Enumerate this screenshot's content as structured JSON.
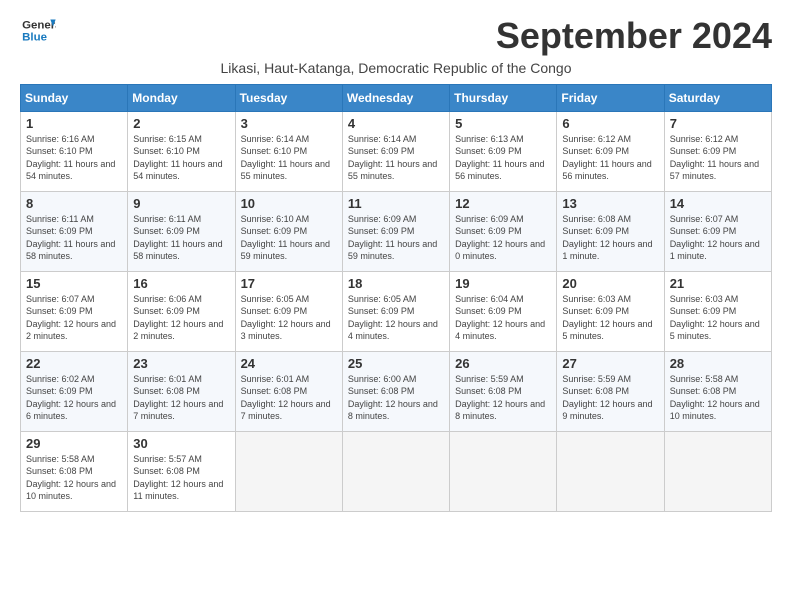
{
  "logo": {
    "line1": "General",
    "line2": "Blue"
  },
  "title": "September 2024",
  "subtitle": "Likasi, Haut-Katanga, Democratic Republic of the Congo",
  "days_of_week": [
    "Sunday",
    "Monday",
    "Tuesday",
    "Wednesday",
    "Thursday",
    "Friday",
    "Saturday"
  ],
  "weeks": [
    [
      {
        "num": "1",
        "sunrise": "6:16 AM",
        "sunset": "6:10 PM",
        "daylight": "11 hours and 54 minutes."
      },
      {
        "num": "2",
        "sunrise": "6:15 AM",
        "sunset": "6:10 PM",
        "daylight": "11 hours and 54 minutes."
      },
      {
        "num": "3",
        "sunrise": "6:14 AM",
        "sunset": "6:10 PM",
        "daylight": "11 hours and 55 minutes."
      },
      {
        "num": "4",
        "sunrise": "6:14 AM",
        "sunset": "6:09 PM",
        "daylight": "11 hours and 55 minutes."
      },
      {
        "num": "5",
        "sunrise": "6:13 AM",
        "sunset": "6:09 PM",
        "daylight": "11 hours and 56 minutes."
      },
      {
        "num": "6",
        "sunrise": "6:12 AM",
        "sunset": "6:09 PM",
        "daylight": "11 hours and 56 minutes."
      },
      {
        "num": "7",
        "sunrise": "6:12 AM",
        "sunset": "6:09 PM",
        "daylight": "11 hours and 57 minutes."
      }
    ],
    [
      {
        "num": "8",
        "sunrise": "6:11 AM",
        "sunset": "6:09 PM",
        "daylight": "11 hours and 58 minutes."
      },
      {
        "num": "9",
        "sunrise": "6:11 AM",
        "sunset": "6:09 PM",
        "daylight": "11 hours and 58 minutes."
      },
      {
        "num": "10",
        "sunrise": "6:10 AM",
        "sunset": "6:09 PM",
        "daylight": "11 hours and 59 minutes."
      },
      {
        "num": "11",
        "sunrise": "6:09 AM",
        "sunset": "6:09 PM",
        "daylight": "11 hours and 59 minutes."
      },
      {
        "num": "12",
        "sunrise": "6:09 AM",
        "sunset": "6:09 PM",
        "daylight": "12 hours and 0 minutes."
      },
      {
        "num": "13",
        "sunrise": "6:08 AM",
        "sunset": "6:09 PM",
        "daylight": "12 hours and 1 minute."
      },
      {
        "num": "14",
        "sunrise": "6:07 AM",
        "sunset": "6:09 PM",
        "daylight": "12 hours and 1 minute."
      }
    ],
    [
      {
        "num": "15",
        "sunrise": "6:07 AM",
        "sunset": "6:09 PM",
        "daylight": "12 hours and 2 minutes."
      },
      {
        "num": "16",
        "sunrise": "6:06 AM",
        "sunset": "6:09 PM",
        "daylight": "12 hours and 2 minutes."
      },
      {
        "num": "17",
        "sunrise": "6:05 AM",
        "sunset": "6:09 PM",
        "daylight": "12 hours and 3 minutes."
      },
      {
        "num": "18",
        "sunrise": "6:05 AM",
        "sunset": "6:09 PM",
        "daylight": "12 hours and 4 minutes."
      },
      {
        "num": "19",
        "sunrise": "6:04 AM",
        "sunset": "6:09 PM",
        "daylight": "12 hours and 4 minutes."
      },
      {
        "num": "20",
        "sunrise": "6:03 AM",
        "sunset": "6:09 PM",
        "daylight": "12 hours and 5 minutes."
      },
      {
        "num": "21",
        "sunrise": "6:03 AM",
        "sunset": "6:09 PM",
        "daylight": "12 hours and 5 minutes."
      }
    ],
    [
      {
        "num": "22",
        "sunrise": "6:02 AM",
        "sunset": "6:09 PM",
        "daylight": "12 hours and 6 minutes."
      },
      {
        "num": "23",
        "sunrise": "6:01 AM",
        "sunset": "6:08 PM",
        "daylight": "12 hours and 7 minutes."
      },
      {
        "num": "24",
        "sunrise": "6:01 AM",
        "sunset": "6:08 PM",
        "daylight": "12 hours and 7 minutes."
      },
      {
        "num": "25",
        "sunrise": "6:00 AM",
        "sunset": "6:08 PM",
        "daylight": "12 hours and 8 minutes."
      },
      {
        "num": "26",
        "sunrise": "5:59 AM",
        "sunset": "6:08 PM",
        "daylight": "12 hours and 8 minutes."
      },
      {
        "num": "27",
        "sunrise": "5:59 AM",
        "sunset": "6:08 PM",
        "daylight": "12 hours and 9 minutes."
      },
      {
        "num": "28",
        "sunrise": "5:58 AM",
        "sunset": "6:08 PM",
        "daylight": "12 hours and 10 minutes."
      }
    ],
    [
      {
        "num": "29",
        "sunrise": "5:58 AM",
        "sunset": "6:08 PM",
        "daylight": "12 hours and 10 minutes."
      },
      {
        "num": "30",
        "sunrise": "5:57 AM",
        "sunset": "6:08 PM",
        "daylight": "12 hours and 11 minutes."
      },
      null,
      null,
      null,
      null,
      null
    ]
  ]
}
